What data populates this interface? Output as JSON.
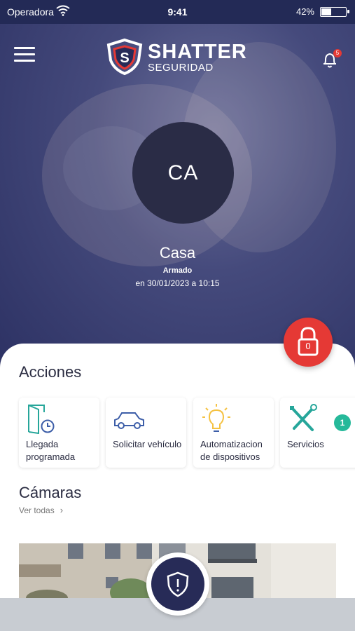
{
  "status_bar": {
    "carrier": "Operadora",
    "time": "9:41",
    "battery": "42%",
    "battery_level": 0.42
  },
  "header": {
    "brand": "SHATTER",
    "brand_sub": "SEGURIDAD",
    "notification_count": "5",
    "menu_icon": "hamburger-menu-icon",
    "notification_icon": "bell-icon"
  },
  "site": {
    "initials": "CA",
    "name": "Casa",
    "status": "Armado",
    "status_time": "en 30/01/2023 a 10:15"
  },
  "lock_button": {
    "count": "0",
    "icon": "padlock-icon"
  },
  "acciones": {
    "title": "Acciones",
    "items": [
      {
        "label": "Llegada programada",
        "icon": "door-clock-icon"
      },
      {
        "label": "Solicitar vehículo",
        "icon": "car-icon"
      },
      {
        "label": "Automatizacion de dispositivos",
        "icon": "lightbulb-icon"
      },
      {
        "label": "Servicios",
        "icon": "tools-icon"
      }
    ],
    "services_badge": "1"
  },
  "camaras": {
    "title": "Cámaras",
    "ver_todas": "Ver todas",
    "chevron": "›"
  },
  "colors": {
    "primary": "#272b57",
    "danger": "#e53935",
    "accent": "#26b99a",
    "icon_blue": "#3d5ea8",
    "icon_teal": "#26a69a",
    "icon_yellow": "#f5c242"
  }
}
